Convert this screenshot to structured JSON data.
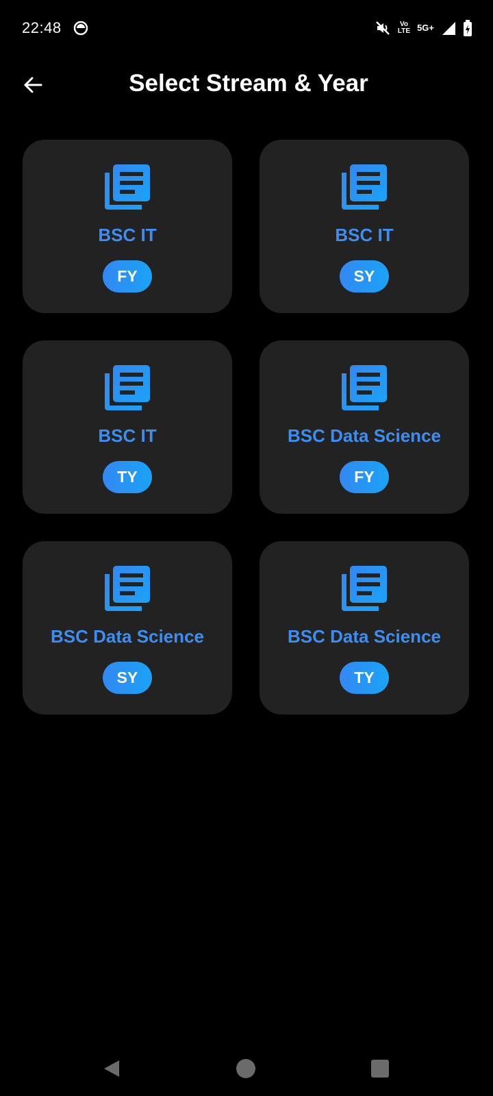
{
  "status_bar": {
    "time": "22:48",
    "network_top": "Vo",
    "network_bottom": "LTE",
    "network_type": "5G+",
    "icons": [
      "notification-icon",
      "mute-icon",
      "signal-icon",
      "battery-charging-icon"
    ]
  },
  "app_bar": {
    "title": "Select Stream & Year",
    "back_icon": "arrow-left-icon"
  },
  "cards": [
    {
      "stream": "BSC IT",
      "year": "FY"
    },
    {
      "stream": "BSC IT",
      "year": "SY"
    },
    {
      "stream": "BSC IT",
      "year": "TY"
    },
    {
      "stream": "BSC Data Science",
      "year": "FY"
    },
    {
      "stream": "BSC Data Science",
      "year": "SY"
    },
    {
      "stream": "BSC Data Science",
      "year": "TY"
    }
  ],
  "card_icon": "library-books-icon",
  "colors": {
    "background": "#000000",
    "card": "#222222",
    "accent": "#3d8ef0",
    "badge_start": "#3388f2",
    "badge_end": "#1aa3f7"
  },
  "nav_bar": {
    "icons": [
      "back-triangle-icon",
      "home-circle-icon",
      "recents-square-icon"
    ]
  }
}
